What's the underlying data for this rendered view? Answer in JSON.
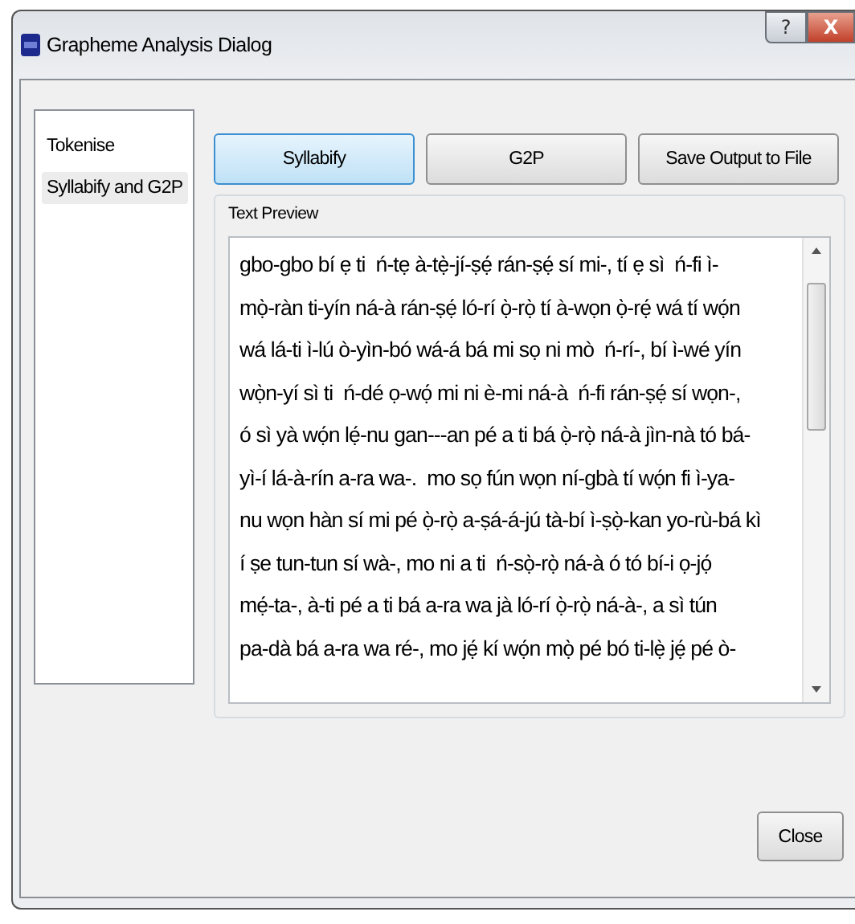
{
  "window": {
    "title": "Grapheme Analysis Dialog",
    "controls": [
      "?",
      "X"
    ]
  },
  "sidebar": {
    "items": [
      {
        "label": "Tokenise",
        "selected": false
      },
      {
        "label": "Syllabify and G2P",
        "selected": true
      }
    ]
  },
  "actions": [
    {
      "label": "Syllabify",
      "selected": true
    },
    {
      "label": "G2P",
      "selected": false
    },
    {
      "label": "Save Output to File",
      "selected": false
    }
  ],
  "text_preview": {
    "title": "Text Preview",
    "lines": [
      "gbo-gbo bí ẹ ti  ń-tẹ à-tẹ̀-jí-ṣẹ́ rán-ṣẹ́ sí mi-, tí ẹ sì  ń-fi ì-",
      "mọ̀-ràn ti-yín ná-à rán-ṣẹ́ ló-rí ọ̀-rọ̀ tí à-wọn ọ̀-rẹ́ wá tí wọ́n",
      "wá lá-ti ì-lú ò-yìn-bó wá-á bá mi sọ ni mò  ń-rí-, bí ì-wé yín",
      "wọ̀n-yí sì ti  ń-dé ọ-wọ́ mi ni è-mi ná-à  ń-fi rán-ṣẹ́ sí wọn-,",
      "ó sì yà wọ́n lẹ́-nu gan---an pé a ti bá ọ̀-rọ̀ ná-à jìn-nà tó bá-",
      "yì-í lá-à-rín a-ra wa-.  mo sọ fún wọn ní-gbà tí wọ́n fi ì-ya-",
      "nu wọn hàn sí mi pé ọ̀-rọ̀ a-ṣá-á-jú tà-bí ì-ṣọ̀-kan yo-rù-bá kì",
      "í ṣe tun-tun sí wà-, mo ni a ti  ń-sọ̀-rọ̀ ná-à ó tó bí-i ọ-jọ́",
      "mẹ́-ta-, à-ti pé a ti bá a-ra wa jà ló-rí ọ̀-rọ̀ ná-à-, a sì tún",
      "pa-dà bá a-ra wa ré-, mo jẹ́ kí wọ́n mọ̀ pé bó ti-lẹ̀ jẹ́ pé ò-"
    ]
  },
  "footer": {
    "close": "Close"
  }
}
